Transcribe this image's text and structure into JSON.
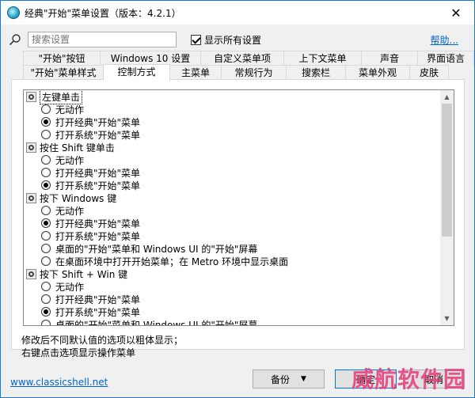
{
  "window": {
    "title": "经典\"开始\"菜单设置（版本：4.2.1）",
    "close_glyph": "✕"
  },
  "search": {
    "placeholder": "搜索设置",
    "show_all_label": "显示所有设置",
    "show_all_checked": true,
    "help_label": "帮助..."
  },
  "tabs": {
    "row1": [
      "\"开始\"按钮",
      "Windows 10 设置",
      "自定义菜单项",
      "上下文菜单",
      "声音",
      "界面语言"
    ],
    "row2": [
      "\"开始\"菜单样式",
      "控制方式",
      "主菜单",
      "常规行为",
      "搜索栏",
      "菜单外观",
      "皮肤"
    ],
    "selected": "控制方式"
  },
  "tree": [
    {
      "type": "header",
      "label": "左键单击",
      "selected": true
    },
    {
      "type": "option",
      "label": "无动作",
      "checked": false
    },
    {
      "type": "option",
      "label": "打开经典\"开始\"菜单",
      "checked": true
    },
    {
      "type": "option",
      "label": "打开系统\"开始\"菜单",
      "checked": false
    },
    {
      "type": "header",
      "label": "按住 Shift 键单击"
    },
    {
      "type": "option",
      "label": "无动作",
      "checked": false
    },
    {
      "type": "option",
      "label": "打开经典\"开始\"菜单",
      "checked": false
    },
    {
      "type": "option",
      "label": "打开系统\"开始\"菜单",
      "checked": true
    },
    {
      "type": "header",
      "label": "按下 Windows 键"
    },
    {
      "type": "option",
      "label": "无动作",
      "checked": false
    },
    {
      "type": "option",
      "label": "打开经典\"开始\"菜单",
      "checked": true
    },
    {
      "type": "option",
      "label": "打开系统\"开始\"菜单",
      "checked": false
    },
    {
      "type": "option",
      "label": "桌面的\"开始\"菜单和 Windows UI 的\"开始\"屏幕",
      "checked": false
    },
    {
      "type": "option",
      "label": "在桌面环境中打开开始菜单；在 Metro 环境中显示桌面",
      "checked": false
    },
    {
      "type": "header",
      "label": "按下 Shift + Win 键"
    },
    {
      "type": "option",
      "label": "无动作",
      "checked": false
    },
    {
      "type": "option",
      "label": "打开经典\"开始\"菜单",
      "checked": false
    },
    {
      "type": "option",
      "label": "打开系统\"开始\"菜单",
      "checked": true
    },
    {
      "type": "option",
      "label": "桌面的\"开始\"菜单和 Windows UI 的\"开始\"屏幕",
      "checked": false
    }
  ],
  "notes": {
    "line1": "修改后不同默认值的选项以粗体显示；",
    "line2": "右键点击选项显示操作菜单"
  },
  "footer": {
    "link": "www.classicshell.net",
    "backup_label": "备份",
    "backup_caret": "▼",
    "ok_label": "确定",
    "cancel_label": "取消"
  },
  "scroll": {
    "up_glyph": "▲",
    "down_glyph": "▼"
  },
  "watermark": "威航软件园",
  "colors": {
    "link": "#0066cc",
    "accent_border": "#0078d7"
  }
}
